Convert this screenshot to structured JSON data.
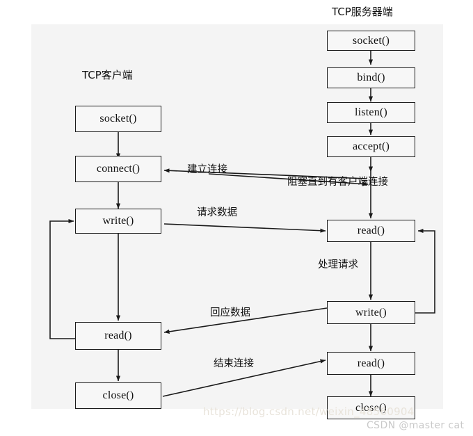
{
  "diagram": {
    "title_client": "TCP客户端",
    "title_server": "TCP服务器端",
    "client_nodes": [
      {
        "id": "c-socket",
        "label": "socket()"
      },
      {
        "id": "c-connect",
        "label": "connect()"
      },
      {
        "id": "c-write",
        "label": "write()"
      },
      {
        "id": "c-read",
        "label": "read()"
      },
      {
        "id": "c-close",
        "label": "close()"
      }
    ],
    "server_nodes": [
      {
        "id": "s-socket",
        "label": "socket()"
      },
      {
        "id": "s-bind",
        "label": "bind()"
      },
      {
        "id": "s-listen",
        "label": "listen()"
      },
      {
        "id": "s-accept",
        "label": "accept()"
      },
      {
        "id": "s-read1",
        "label": "read()"
      },
      {
        "id": "s-write",
        "label": "write()"
      },
      {
        "id": "s-read2",
        "label": "read()"
      },
      {
        "id": "s-close",
        "label": "close()"
      }
    ],
    "edge_labels": [
      {
        "id": "lbl-establish",
        "text": "建立连接"
      },
      {
        "id": "lbl-block",
        "text": "阻塞直到有客户端连接"
      },
      {
        "id": "lbl-request",
        "text": "请求数据"
      },
      {
        "id": "lbl-process",
        "text": "处理请求"
      },
      {
        "id": "lbl-response",
        "text": "回应数据"
      },
      {
        "id": "lbl-finish",
        "text": "结束连接"
      }
    ],
    "watermark": {
      "url": "https://blog.csdn.net/weixin_48560904",
      "author": "CSDN @master cat"
    },
    "colors": {
      "background": "#ffffff",
      "panel": "#f4f4f4",
      "node_fill": "#f7f7f7",
      "stroke": "#1a1a1a",
      "text": "#111111"
    }
  }
}
